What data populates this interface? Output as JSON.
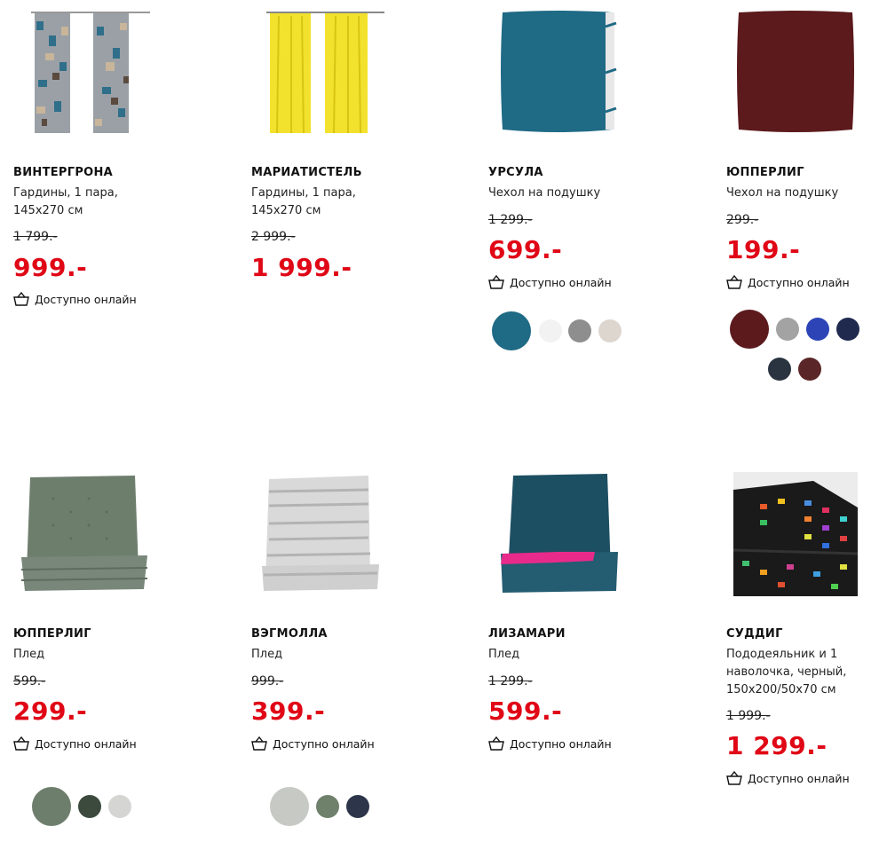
{
  "products": [
    {
      "name": "ВИНТЕРГРОНА",
      "desc_lines": [
        "Гардины, 1 пара,",
        "145x270 см"
      ],
      "old_price": "1 799.-",
      "price": "999.-",
      "availability": "Доступно онлайн"
    },
    {
      "name": "МАРИАТИСТЕЛЬ",
      "desc_lines": [
        "Гардины, 1 пара,",
        "145x270 см"
      ],
      "old_price": "2 999.-",
      "price": "1 999.-",
      "availability": "Доступно онлайн"
    },
    {
      "name": "УРСУЛА",
      "desc_lines": [
        "Чехол на подушку"
      ],
      "old_price": "1 299.-",
      "price": "699.-",
      "availability": "Доступно онлайн",
      "swatches": [
        "#1f6a85",
        "#f2f2f2",
        "#8e8e8e",
        "#ddd6cf"
      ]
    },
    {
      "name": "ЮППЕРЛИГ",
      "desc_lines": [
        "Чехол на подушку"
      ],
      "old_price": "299.-",
      "price": "199.-",
      "availability": "Доступно онлайн",
      "swatches": [
        "#5c1a1d",
        "#a3a3a3",
        "#2c44b6",
        "#1f2a4e",
        "#2a3440",
        "#5b2627"
      ]
    },
    {
      "name": "ЮППЕРЛИГ",
      "desc_lines": [
        "Плед"
      ],
      "old_price": "599.-",
      "price": "299.-",
      "availability": "Доступно онлайн",
      "swatches": [
        "#6e7e6d",
        "#3c4a3e",
        "#d5d6d4"
      ]
    },
    {
      "name": "ВЭГМОЛЛА",
      "desc_lines": [
        "Плед"
      ],
      "old_price": "999.-",
      "price": "399.-",
      "availability": "Доступно онлайн",
      "swatches": [
        "#c7c9c4",
        "#6f806b",
        "#2c3549"
      ]
    },
    {
      "name": "ЛИЗАМАРИ",
      "desc_lines": [
        "Плед"
      ],
      "old_price": "1 299.-",
      "price": "599.-",
      "availability": "Доступно онлайн"
    },
    {
      "name": "СУДДИГ",
      "desc_lines": [
        "Пододеяльник и 1",
        "наволочка, черный,",
        "150x200/50x70 см"
      ],
      "old_price": "1 999.-",
      "price": "1 299.-",
      "availability": "Доступно онлайн"
    }
  ],
  "colors": {
    "price_red": "#e00716"
  }
}
